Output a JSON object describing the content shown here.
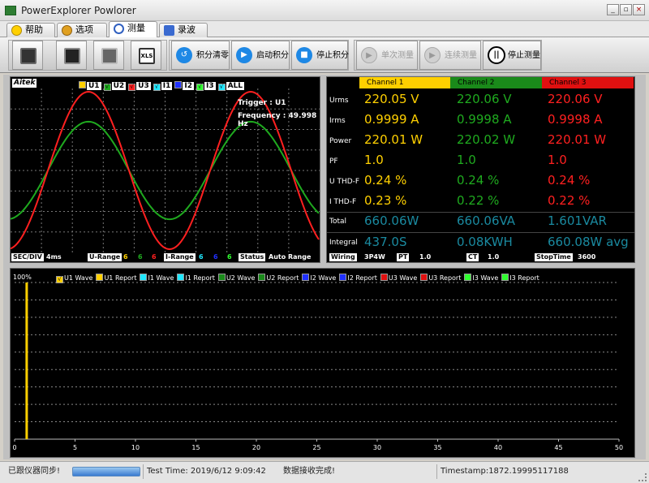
{
  "window": {
    "title": "PowerExplorer Powlorer",
    "min": "_",
    "max": "▫",
    "close": "×"
  },
  "tabs": [
    {
      "label": "帮助"
    },
    {
      "label": "选项"
    },
    {
      "label": "测量"
    },
    {
      "label": "录波"
    }
  ],
  "toolbar": {
    "integral_reset": "积分清零",
    "integral_start": "启动积分",
    "integral_stop": "停止积分",
    "single_measure": "单次测量",
    "continuous_measure": "连续测量",
    "stop_measure": "停止测量",
    "xls_label": "XLS"
  },
  "waveform": {
    "brand": "Aitek",
    "channels": [
      {
        "label": "U1",
        "color": "#ffd000",
        "checked": false
      },
      {
        "label": "U2",
        "color": "#1faa1f",
        "checked": true
      },
      {
        "label": "U3",
        "color": "#ff2020",
        "checked": true
      },
      {
        "label": "I1",
        "color": "#20e8ff",
        "checked": true
      },
      {
        "label": "I2",
        "color": "#2030ff",
        "checked": false
      },
      {
        "label": "I3",
        "color": "#30ff30",
        "checked": true
      },
      {
        "label": "ALL",
        "color": "#20e8ff",
        "checked": true
      }
    ],
    "trigger": "Trigger : U1",
    "frequency": "Frequency : 49.998 Hz",
    "sec_div_label": "SEC/DIV",
    "sec_div_value": "4ms",
    "u_range_label": "U-Range",
    "u_range_values": [
      "6",
      "6",
      "6"
    ],
    "i_range_label": "I-Range",
    "i_range_values": [
      "6",
      "6",
      "6"
    ],
    "status_label": "Status",
    "status_value": "Auto Range"
  },
  "measurement": {
    "channels": [
      {
        "label": "Channel 1",
        "color": "#ffd000"
      },
      {
        "label": "Channel 2",
        "color": "#1a8a1a"
      },
      {
        "label": "Channel 3",
        "color": "#e01010"
      }
    ],
    "rows": [
      {
        "label": "Urms",
        "values": [
          "220.05 V",
          "220.06 V",
          "220.06 V"
        ]
      },
      {
        "label": "Irms",
        "values": [
          "0.9999 A",
          "0.9998 A",
          "0.9998 A"
        ]
      },
      {
        "label": "Power",
        "values": [
          "220.01 W",
          "220.02 W",
          "220.01 W"
        ]
      },
      {
        "label": "PF",
        "values": [
          "1.0",
          "1.0",
          "1.0"
        ]
      },
      {
        "label": "U THD-F",
        "values": [
          "0.24 %",
          "0.24 %",
          "0.24 %"
        ]
      },
      {
        "label": "I THD-F",
        "values": [
          "0.23 %",
          "0.22 %",
          "0.22 %"
        ]
      }
    ],
    "total_label": "Total",
    "total_values": [
      "660.06W",
      "660.06VA",
      "1.601VAR"
    ],
    "integral_label": "Integral",
    "integral_values": [
      "437.0S",
      "0.08KWH",
      "660.08W avg"
    ],
    "wiring_label": "Wiring",
    "wiring_value": "3P4W",
    "pt_label": "PT",
    "pt_value": "1.0",
    "ct_label": "CT",
    "ct_value": "1.0",
    "stoptime_label": "StopTime",
    "stoptime_value": "3600"
  },
  "report": {
    "y_label": "100%",
    "legend": [
      {
        "label": "U1 Wave",
        "color": "#ffd000",
        "checked": true
      },
      {
        "label": "U1 Report",
        "color": "#ffd000",
        "checked": false
      },
      {
        "label": "I1 Wave",
        "color": "#20e8ff",
        "checked": false
      },
      {
        "label": "I1 Report",
        "color": "#20e8ff",
        "checked": false
      },
      {
        "label": "U2 Wave",
        "color": "#1a8a1a",
        "checked": false
      },
      {
        "label": "U2 Report",
        "color": "#1a8a1a",
        "checked": false
      },
      {
        "label": "I2 Wave",
        "color": "#2030ff",
        "checked": false
      },
      {
        "label": "I2 Report",
        "color": "#2030ff",
        "checked": false
      },
      {
        "label": "U3 Wave",
        "color": "#e01010",
        "checked": false
      },
      {
        "label": "U3 Report",
        "color": "#e01010",
        "checked": false
      },
      {
        "label": "I3 Wave",
        "color": "#30ff30",
        "checked": false
      },
      {
        "label": "I3 Report",
        "color": "#30ff30",
        "checked": false
      }
    ],
    "x_ticks": [
      "0",
      "5",
      "10",
      "15",
      "20",
      "25",
      "30",
      "35",
      "40",
      "45",
      "50"
    ]
  },
  "chart_data": [
    {
      "type": "line",
      "title": "",
      "series": [
        {
          "name": "U2",
          "color": "#1faa1f",
          "amplitude": 0.62
        },
        {
          "name": "U3",
          "color": "#ff2020",
          "amplitude": 1.0
        }
      ],
      "sec_div": "4ms",
      "grid": true
    },
    {
      "type": "line",
      "x": [
        0,
        50
      ],
      "xlim": [
        0,
        50
      ],
      "ylabel": "100%",
      "grid": true,
      "series": [
        {
          "name": "U1 Wave",
          "x": [
            1,
            1
          ],
          "y": [
            0,
            100
          ],
          "color": "#ffd000"
        }
      ]
    }
  ],
  "status": {
    "sync": "已跟仪器同步!",
    "test_time": "Test Time: 2019/6/12 9:09:42",
    "data_status": "数据接收完成!",
    "timestamp": "Timestamp:1872.19995117188"
  }
}
